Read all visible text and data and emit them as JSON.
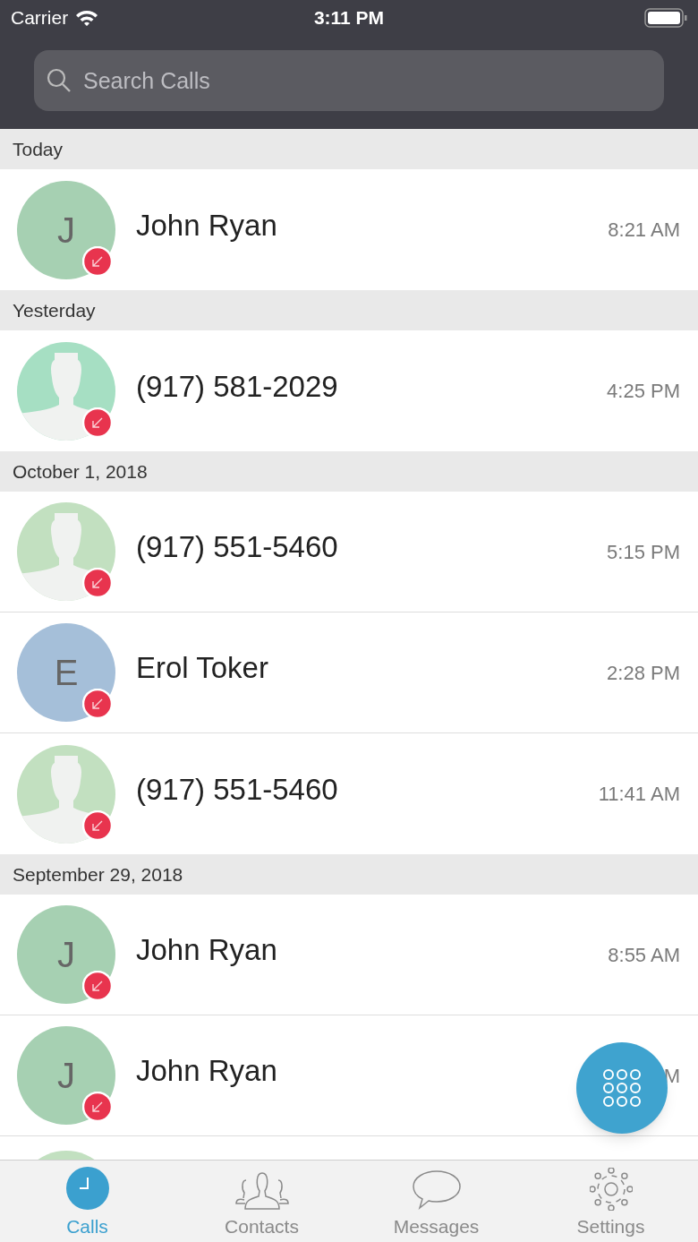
{
  "status_bar": {
    "carrier": "Carrier",
    "time": "3:11 PM"
  },
  "search": {
    "placeholder": "Search Calls"
  },
  "sections": [
    {
      "title": "Today",
      "calls": [
        {
          "avatar": {
            "kind": "initial",
            "letter": "J",
            "color": "#a6d0b2"
          },
          "name": "John Ryan",
          "time": "8:21 AM",
          "missed": true
        }
      ]
    },
    {
      "title": "Yesterday",
      "calls": [
        {
          "avatar": {
            "kind": "silhouette",
            "color": "#a6dfc3"
          },
          "name": "(917) 581-2029",
          "time": "4:25 PM",
          "missed": true
        }
      ]
    },
    {
      "title": "October 1, 2018",
      "calls": [
        {
          "avatar": {
            "kind": "silhouette",
            "color": "#c2e0c0"
          },
          "name": "(917) 551-5460",
          "time": "5:15 PM",
          "missed": true
        },
        {
          "avatar": {
            "kind": "initial",
            "letter": "E",
            "color": "#a5bfd9"
          },
          "name": "Erol Toker",
          "time": "2:28 PM",
          "missed": true
        },
        {
          "avatar": {
            "kind": "silhouette",
            "color": "#c2e0c0"
          },
          "name": "(917) 551-5460",
          "time": "11:41 AM",
          "missed": true
        }
      ]
    },
    {
      "title": "September 29, 2018",
      "calls": [
        {
          "avatar": {
            "kind": "initial",
            "letter": "J",
            "color": "#a6d0b2"
          },
          "name": "John Ryan",
          "time": "8:55 AM",
          "missed": true
        },
        {
          "avatar": {
            "kind": "initial",
            "letter": "J",
            "color": "#a6d0b2"
          },
          "name": "John Ryan",
          "time": "M",
          "missed": true
        }
      ]
    }
  ],
  "peek_row": {
    "color": "#c2e0c0"
  },
  "tabs": [
    {
      "label": "Calls",
      "kind": "calls",
      "selected": true
    },
    {
      "label": "Contacts",
      "kind": "contacts",
      "selected": false
    },
    {
      "label": "Messages",
      "kind": "messages",
      "selected": false
    },
    {
      "label": "Settings",
      "kind": "settings",
      "selected": false
    }
  ]
}
